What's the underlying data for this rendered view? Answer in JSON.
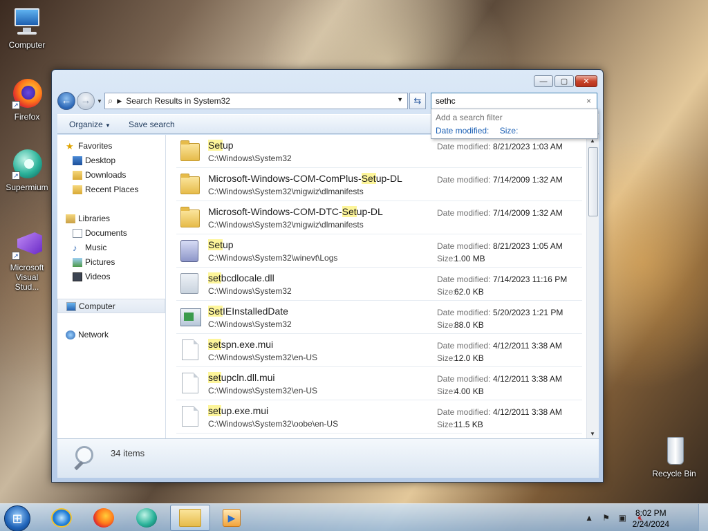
{
  "desktop": {
    "icons": [
      {
        "label": "Computer"
      },
      {
        "label": "Firefox"
      },
      {
        "label": "Supermium"
      },
      {
        "label": "Microsoft Visual Stud..."
      },
      {
        "label": "Recycle Bin"
      }
    ]
  },
  "explorer": {
    "address": "Search Results in System32",
    "search_value": "sethc",
    "suggest": {
      "header": "Add a search filter",
      "filters": [
        "Date modified:",
        "Size:"
      ]
    },
    "toolbar": {
      "organize": "Organize",
      "save_search": "Save search"
    },
    "nav": {
      "favorites": "Favorites",
      "desktop": "Desktop",
      "downloads": "Downloads",
      "recent": "Recent Places",
      "libraries": "Libraries",
      "documents": "Documents",
      "music": "Music",
      "pictures": "Pictures",
      "videos": "Videos",
      "computer": "Computer",
      "network": "Network"
    },
    "date_label": "Date modified:",
    "size_label": "Size:",
    "results": [
      {
        "pre": "",
        "hl": "Set",
        "post": "up",
        "path": "C:\\Windows\\System32",
        "date": "8/21/2023 1:03 AM",
        "size": "",
        "icon": "folder"
      },
      {
        "pre": "Microsoft-Windows-COM-ComPlus-",
        "hl": "Set",
        "post": "up-DL",
        "path": "C:\\Windows\\System32\\migwiz\\dlmanifests",
        "date": "7/14/2009 1:32 AM",
        "size": "",
        "icon": "folder"
      },
      {
        "pre": "Microsoft-Windows-COM-DTC-",
        "hl": "Set",
        "post": "up-DL",
        "path": "C:\\Windows\\System32\\migwiz\\dlmanifests",
        "date": "7/14/2009 1:32 AM",
        "size": "",
        "icon": "folder"
      },
      {
        "pre": "",
        "hl": "Set",
        "post": "up",
        "path": "C:\\Windows\\System32\\winevt\\Logs",
        "date": "8/21/2023 1:05 AM",
        "size": "1.00 MB",
        "icon": "log"
      },
      {
        "pre": "",
        "hl": "set",
        "post": "bcdlocale.dll",
        "path": "C:\\Windows\\System32",
        "date": "7/14/2023 11:16 PM",
        "size": "62.0 KB",
        "icon": "cfg"
      },
      {
        "pre": "",
        "hl": "Set",
        "post": "IEInstalledDate",
        "path": "C:\\Windows\\System32",
        "date": "5/20/2023 1:21 PM",
        "size": "88.0 KB",
        "icon": "app"
      },
      {
        "pre": "",
        "hl": "set",
        "post": "spn.exe.mui",
        "path": "C:\\Windows\\System32\\en-US",
        "date": "4/12/2011 3:38 AM",
        "size": "12.0 KB",
        "icon": "doc"
      },
      {
        "pre": "",
        "hl": "set",
        "post": "upcln.dll.mui",
        "path": "C:\\Windows\\System32\\en-US",
        "date": "4/12/2011 3:38 AM",
        "size": "4.00 KB",
        "icon": "doc"
      },
      {
        "pre": "",
        "hl": "set",
        "post": "up.exe.mui",
        "path": "C:\\Windows\\System32\\oobe\\en-US",
        "date": "4/12/2011 3:38 AM",
        "size": "11.5 KB",
        "icon": "doc"
      }
    ],
    "status": "34 items"
  },
  "taskbar": {
    "time": "8:02 PM",
    "date": "2/24/2024"
  }
}
